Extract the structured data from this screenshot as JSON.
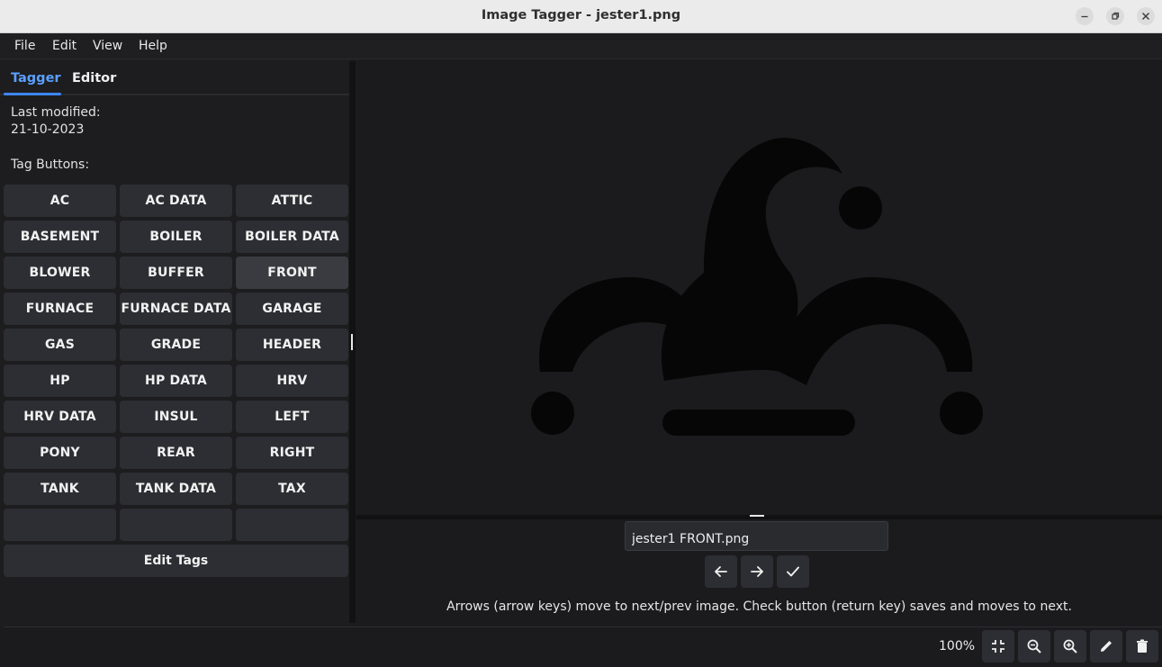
{
  "window": {
    "title": "Image Tagger - jester1.png",
    "controls": [
      "minimize-icon",
      "maximize-icon",
      "close-icon"
    ]
  },
  "menubar": {
    "items": [
      "File",
      "Edit",
      "View",
      "Help"
    ]
  },
  "tabs": {
    "items": [
      "Tagger",
      "Editor"
    ],
    "active": "Tagger"
  },
  "info": {
    "last_modified_label": "Last modified:",
    "last_modified_value": "21-10-2023",
    "tag_buttons_label": "Tag Buttons:"
  },
  "tags": [
    "AC",
    "AC DATA",
    "ATTIC",
    "BASEMENT",
    "BOILER",
    "BOILER DATA",
    "BLOWER",
    "BUFFER",
    "FRONT",
    "FURNACE",
    "FURNACE DATA",
    "GARAGE",
    "GAS",
    "GRADE",
    "HEADER",
    "HP",
    "HP DATA",
    "HRV",
    "HRV DATA",
    "INSUL",
    "LEFT",
    "PONY",
    "REAR",
    "RIGHT",
    "TANK",
    "TANK DATA",
    "TAX",
    "",
    "",
    ""
  ],
  "edit_tags_label": "Edit Tags",
  "filename": {
    "value": "jester1 FRONT.png"
  },
  "nav": {
    "icons": [
      "arrow-left-icon",
      "arrow-right-icon",
      "check-icon"
    ]
  },
  "hint": "Arrows (arrow keys) move to next/prev image. Check button (return key) saves and moves to next.",
  "bottom_bar": {
    "zoom": "100%",
    "tools": [
      "fit-icon",
      "zoom-out-icon",
      "zoom-in-icon",
      "pencil-icon",
      "trash-icon"
    ]
  },
  "colors": {
    "accent": "#3d86ff",
    "background": "#1b1b1d",
    "button": "#2d2e33"
  }
}
